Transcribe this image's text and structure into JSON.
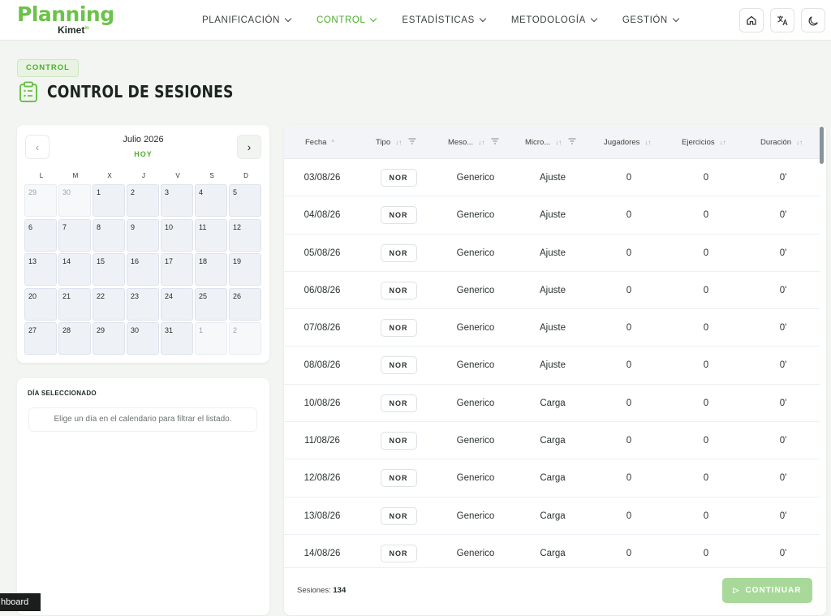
{
  "app": {
    "logo_main": "Planning",
    "logo_sub": "Kimet",
    "logo_sup": "in",
    "brand_color": "#6cc24a"
  },
  "nav": {
    "items": [
      {
        "label": "PLANIFICACIÓN",
        "active": false
      },
      {
        "label": "CONTROL",
        "active": true
      },
      {
        "label": "ESTADÍSTICAS",
        "active": false
      },
      {
        "label": "METODOLOGÍA",
        "active": false
      },
      {
        "label": "GESTIÓN",
        "active": false
      }
    ],
    "icons": [
      "home-icon",
      "translate-icon",
      "moon-icon"
    ]
  },
  "header": {
    "breadcrumb": "CONTROL",
    "title": "CONTROL DE SESIONES",
    "title_icon": "clipboard-list-icon"
  },
  "calendar": {
    "month": "Julio 2026",
    "today_label": "HOY",
    "weekdays": [
      "L",
      "M",
      "X",
      "J",
      "V",
      "S",
      "D"
    ],
    "days": [
      {
        "n": "29",
        "muted": true
      },
      {
        "n": "30",
        "muted": true
      },
      {
        "n": "1"
      },
      {
        "n": "2"
      },
      {
        "n": "3"
      },
      {
        "n": "4"
      },
      {
        "n": "5"
      },
      {
        "n": "6"
      },
      {
        "n": "7"
      },
      {
        "n": "8"
      },
      {
        "n": "9"
      },
      {
        "n": "10"
      },
      {
        "n": "11"
      },
      {
        "n": "12"
      },
      {
        "n": "13"
      },
      {
        "n": "14"
      },
      {
        "n": "15"
      },
      {
        "n": "16"
      },
      {
        "n": "17"
      },
      {
        "n": "18"
      },
      {
        "n": "19"
      },
      {
        "n": "20"
      },
      {
        "n": "21"
      },
      {
        "n": "22"
      },
      {
        "n": "23"
      },
      {
        "n": "24"
      },
      {
        "n": "25"
      },
      {
        "n": "26"
      },
      {
        "n": "27"
      },
      {
        "n": "28"
      },
      {
        "n": "29"
      },
      {
        "n": "30"
      },
      {
        "n": "31"
      },
      {
        "n": "1",
        "muted": true
      },
      {
        "n": "2",
        "muted": true
      }
    ]
  },
  "selected_day": {
    "title": "DÍA SELECCIONADO",
    "empty_text": "Elige un día en el calendario para filtrar el listado."
  },
  "table": {
    "columns": [
      {
        "label": "Fecha",
        "sort": "^"
      },
      {
        "label": "Tipo",
        "sort": "↓↑",
        "filter": true
      },
      {
        "label": "Meso...",
        "sort": "↓↑",
        "filter": true
      },
      {
        "label": "Micro...",
        "sort": "↓↑",
        "filter": true
      },
      {
        "label": "Jugadores",
        "sort": "↓↑"
      },
      {
        "label": "Ejercicios",
        "sort": "↓↑"
      },
      {
        "label": "Duración",
        "sort": "↓↑"
      }
    ],
    "rows": [
      [
        "03/08/26",
        "NOR",
        "Generico",
        "Ajuste",
        "0",
        "0",
        "0'"
      ],
      [
        "04/08/26",
        "NOR",
        "Generico",
        "Ajuste",
        "0",
        "0",
        "0'"
      ],
      [
        "05/08/26",
        "NOR",
        "Generico",
        "Ajuste",
        "0",
        "0",
        "0'"
      ],
      [
        "06/08/26",
        "NOR",
        "Generico",
        "Ajuste",
        "0",
        "0",
        "0'"
      ],
      [
        "07/08/26",
        "NOR",
        "Generico",
        "Ajuste",
        "0",
        "0",
        "0'"
      ],
      [
        "08/08/26",
        "NOR",
        "Generico",
        "Ajuste",
        "0",
        "0",
        "0'"
      ],
      [
        "10/08/26",
        "NOR",
        "Generico",
        "Carga",
        "0",
        "0",
        "0'"
      ],
      [
        "11/08/26",
        "NOR",
        "Generico",
        "Carga",
        "0",
        "0",
        "0'"
      ],
      [
        "12/08/26",
        "NOR",
        "Generico",
        "Carga",
        "0",
        "0",
        "0'"
      ],
      [
        "13/08/26",
        "NOR",
        "Generico",
        "Carga",
        "0",
        "0",
        "0'"
      ],
      [
        "14/08/26",
        "NOR",
        "Generico",
        "Carga",
        "0",
        "0",
        "0'"
      ]
    ],
    "count_label": "Sesiones:",
    "count_value": "134",
    "continue_label": "CONTINUAR"
  },
  "tooltip": {
    "text": "hboard"
  }
}
